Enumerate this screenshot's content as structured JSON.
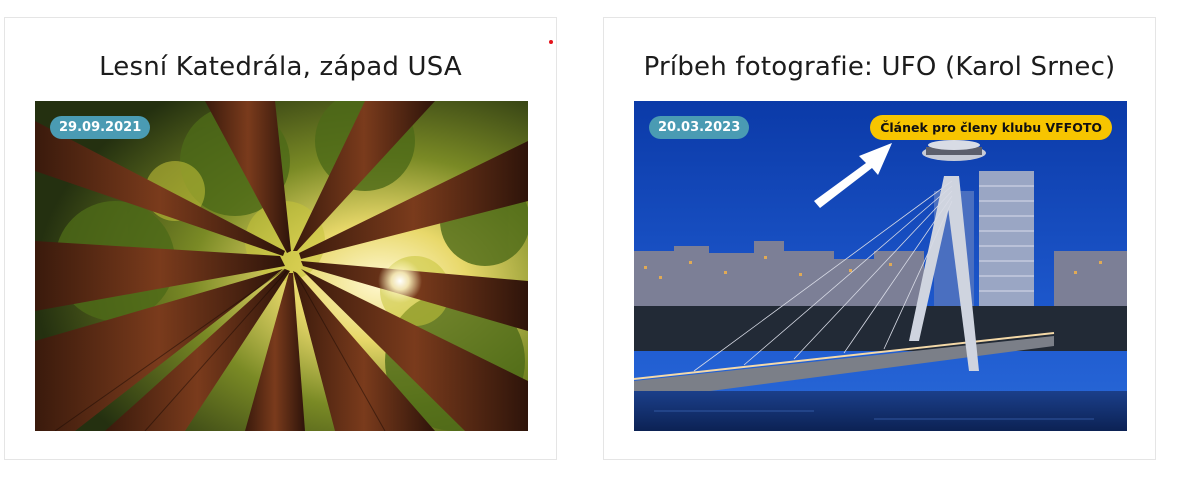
{
  "cards": [
    {
      "title": "Lesní Katedrála, západ USA",
      "date": "29.09.2021",
      "image": "redwood-forest-canopy"
    },
    {
      "title": "Príbeh fotografie: UFO (Karol Srnec)",
      "date": "20.03.2023",
      "badge": "Článek pro členy klubu VFFOTO",
      "image": "bratislava-ufo-bridge-night"
    }
  ],
  "colors": {
    "date_badge": "#4a9bb3",
    "member_badge": "#f7c500",
    "notice_dot": "#e4141b"
  }
}
